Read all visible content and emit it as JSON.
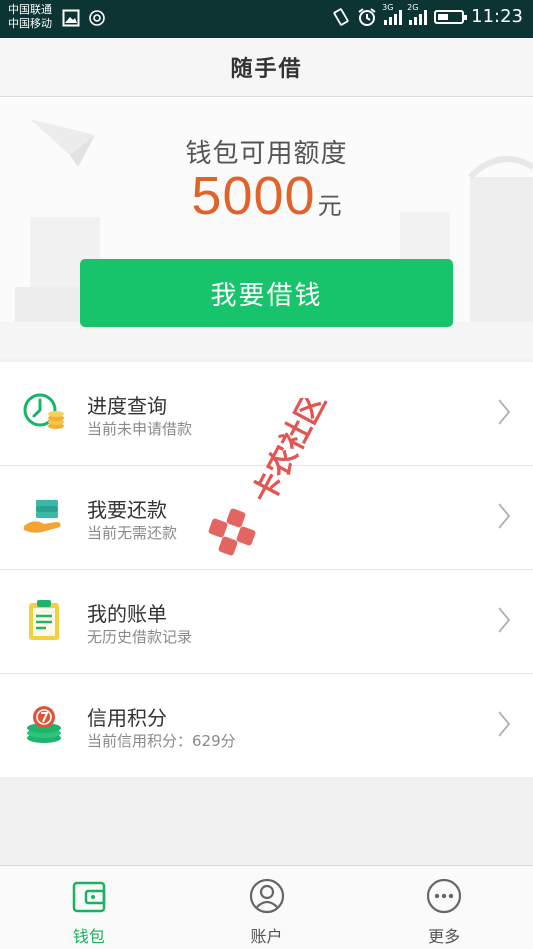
{
  "status_bar": {
    "carrier1": "中国联通",
    "carrier2": "中国移动",
    "sig1": "3G",
    "sig2": "2G",
    "battery_level": 0.45,
    "time": "11:23"
  },
  "header": {
    "title": "随手借"
  },
  "hero": {
    "quota_label": "钱包可用额度",
    "quota_amount": "5000",
    "quota_unit": "元",
    "borrow_button": "我要借钱"
  },
  "menu": [
    {
      "icon": "clock-coins-icon",
      "title": "进度查询",
      "subtitle": "当前未申请借款"
    },
    {
      "icon": "hand-money-icon",
      "title": "我要还款",
      "subtitle": "当前无需还款"
    },
    {
      "icon": "clipboard-icon",
      "title": "我的账单",
      "subtitle": "无历史借款记录"
    },
    {
      "icon": "coin-stack-icon",
      "title": "信用积分",
      "subtitle": "当前信用积分：629分"
    }
  ],
  "watermark": "卡农社区",
  "bottom_nav": [
    {
      "icon": "wallet-icon",
      "label": "钱包",
      "active": true
    },
    {
      "icon": "user-icon",
      "label": "账户",
      "active": false
    },
    {
      "icon": "more-icon",
      "label": "更多",
      "active": false
    }
  ],
  "colors": {
    "accent": "#17c46b",
    "amount": "#e0632a",
    "status_bar": "#0b3433"
  }
}
